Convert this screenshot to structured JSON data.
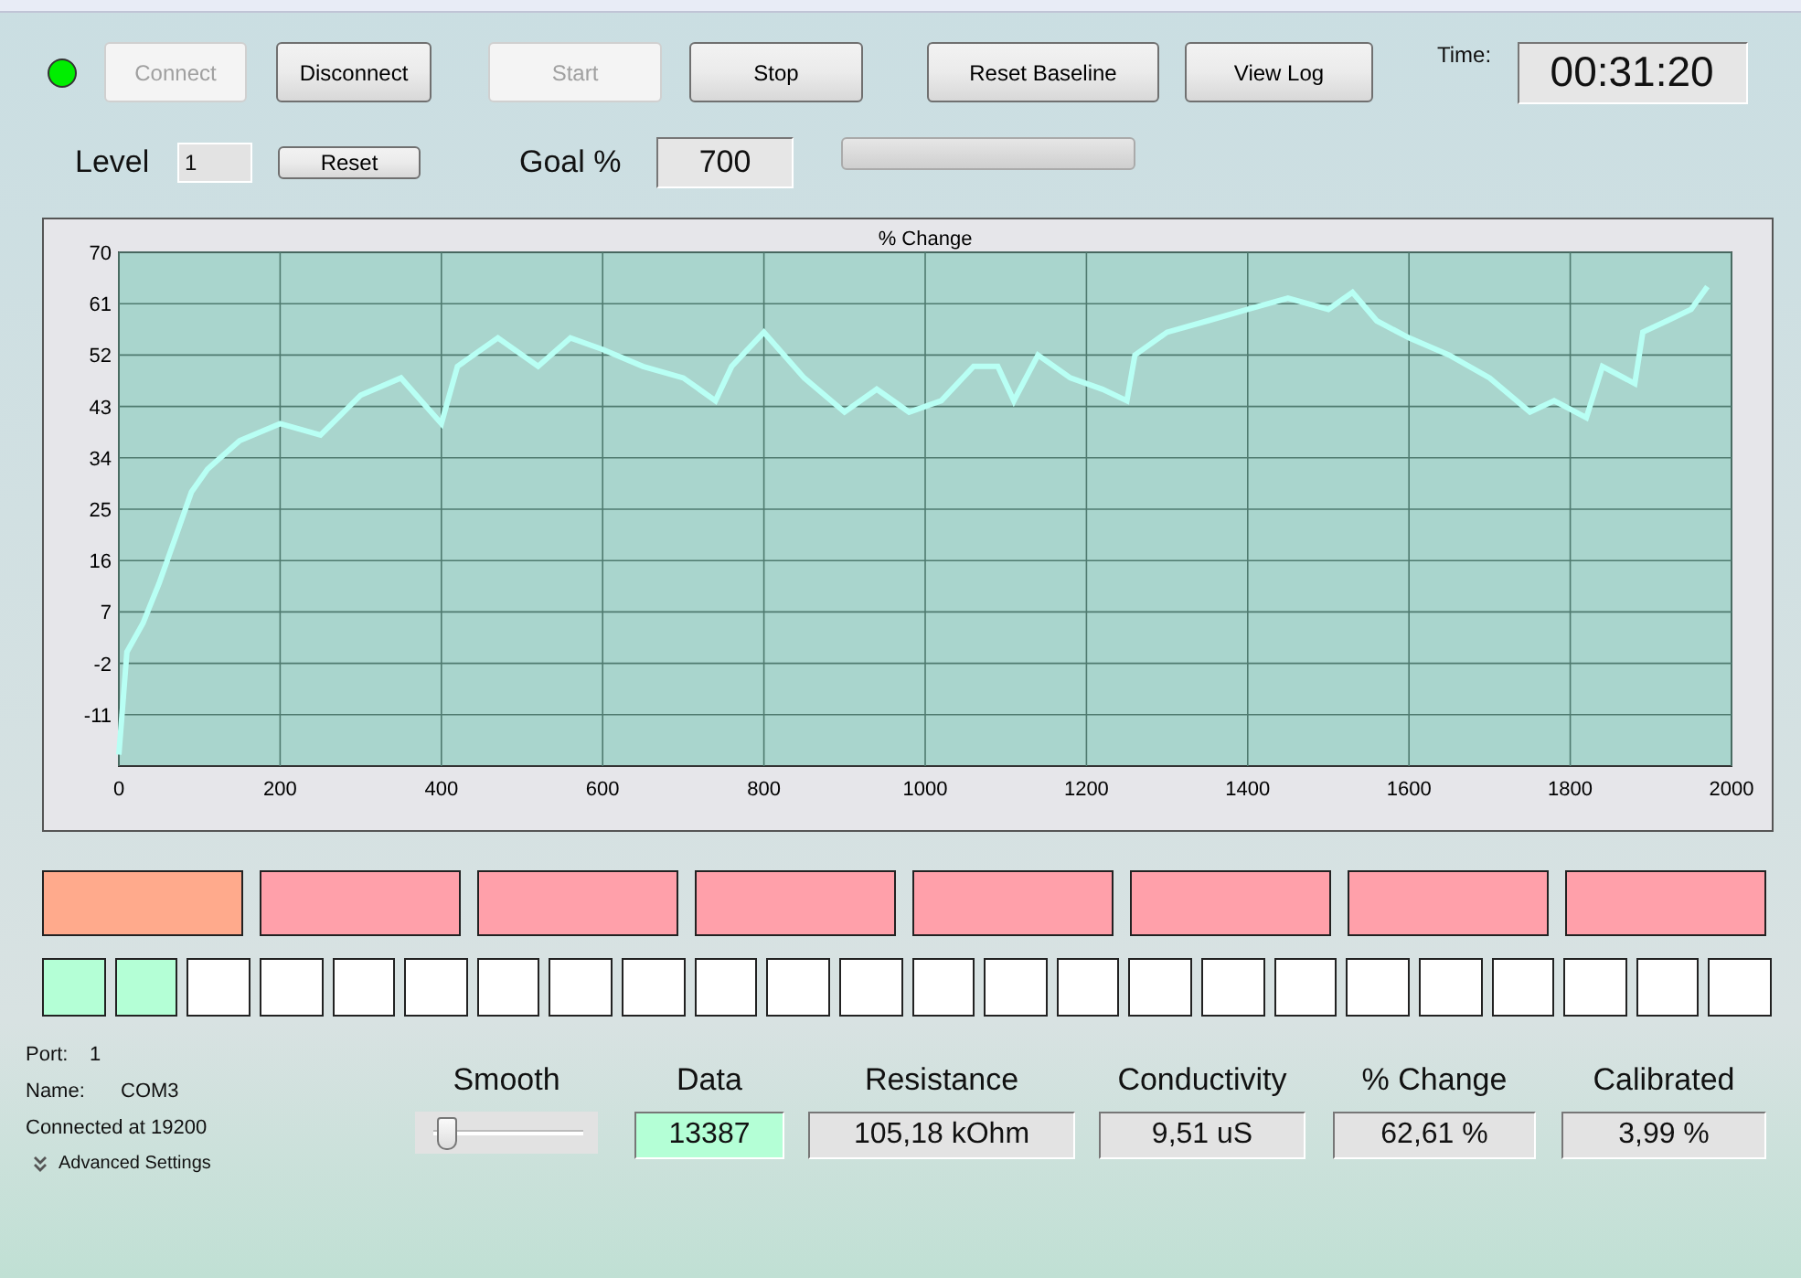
{
  "toolbar": {
    "status_led": {
      "on": true
    },
    "buttons": [
      {
        "label": "Connect",
        "disabled": true
      },
      {
        "label": "Disconnect",
        "disabled": false
      },
      {
        "label": "Start",
        "disabled": true
      },
      {
        "label": "Stop",
        "disabled": false
      },
      {
        "label": "Reset Baseline",
        "disabled": false
      },
      {
        "label": "View Log",
        "disabled": false
      }
    ],
    "time_label": "Time:",
    "time": "00:31:20"
  },
  "level_row": {
    "level_label": "Level",
    "level_value": "1",
    "reset_button": "Reset",
    "goal_label": "Goal %",
    "goal_value": "700",
    "progress": {
      "level": 0
    }
  },
  "chart_data": {
    "type": "line",
    "title": "% Change",
    "grid": true,
    "xlim": [
      0,
      2000
    ],
    "ylim": [
      -20,
      70
    ],
    "xticks": [
      0,
      200,
      400,
      600,
      800,
      1000,
      1200,
      1400,
      1600,
      1800,
      2000
    ],
    "yticks": [
      -11,
      -2,
      7,
      16,
      25,
      34,
      43,
      52,
      61,
      70
    ],
    "x": [
      0,
      10,
      30,
      50,
      70,
      90,
      110,
      150,
      200,
      250,
      300,
      350,
      400,
      420,
      470,
      520,
      560,
      600,
      650,
      700,
      740,
      760,
      800,
      850,
      900,
      940,
      980,
      1020,
      1060,
      1090,
      1110,
      1140,
      1180,
      1220,
      1250,
      1260,
      1300,
      1350,
      1400,
      1450,
      1500,
      1530,
      1560,
      1600,
      1650,
      1700,
      1750,
      1780,
      1820,
      1840,
      1880,
      1890,
      1920,
      1950,
      1970
    ],
    "series": [
      {
        "color": "#b8fff4",
        "values": [
          -18,
          0,
          5,
          12,
          20,
          28,
          32,
          37,
          40,
          38,
          45,
          48,
          40,
          50,
          55,
          50,
          55,
          53,
          50,
          48,
          44,
          50,
          56,
          48,
          42,
          46,
          42,
          44,
          50,
          50,
          44,
          52,
          48,
          46,
          44,
          52,
          56,
          58,
          60,
          62,
          60,
          63,
          58,
          55,
          52,
          48,
          42,
          44,
          41,
          50,
          47,
          56,
          58,
          60,
          64
        ]
      }
    ]
  },
  "stage_blocks": [
    {
      "color": "#ffaa8c"
    },
    {
      "color": "#ffa0aa"
    },
    {
      "color": "#ffa0aa"
    },
    {
      "color": "#ffa0aa"
    },
    {
      "color": "#ffa0aa"
    },
    {
      "color": "#ffa0aa"
    },
    {
      "color": "#ffa0aa"
    },
    {
      "color": "#ffa0aa"
    }
  ],
  "step_cells": [
    {
      "color": "#b4ffd6"
    },
    {
      "color": "#b4ffd6"
    },
    {
      "color": "#ffffff"
    },
    {
      "color": "#ffffff"
    },
    {
      "color": "#ffffff"
    },
    {
      "color": "#ffffff"
    },
    {
      "color": "#ffffff"
    },
    {
      "color": "#ffffff"
    },
    {
      "color": "#ffffff"
    },
    {
      "color": "#ffffff"
    },
    {
      "color": "#ffffff"
    },
    {
      "color": "#ffffff"
    },
    {
      "color": "#ffffff"
    },
    {
      "color": "#ffffff"
    },
    {
      "color": "#ffffff"
    },
    {
      "color": "#ffffff"
    },
    {
      "color": "#ffffff"
    },
    {
      "color": "#ffffff"
    },
    {
      "color": "#ffffff"
    },
    {
      "color": "#ffffff"
    },
    {
      "color": "#ffffff"
    },
    {
      "color": "#ffffff"
    },
    {
      "color": "#ffffff"
    },
    {
      "color": "#ffffff"
    }
  ],
  "connection": {
    "port_label": "Port:",
    "port": "1",
    "name_label": "Name:",
    "name": "COM3",
    "status": "Connected at 19200",
    "advanced": "Advanced Settings"
  },
  "smooth": {
    "label": "Smooth",
    "level": 0.05
  },
  "readouts": [
    {
      "label": "Data",
      "value": "13387",
      "highlighted": true
    },
    {
      "label": "Resistance",
      "value": "105,18 kOhm",
      "highlighted": false
    },
    {
      "label": "Conductivity",
      "value": "9,51 uS",
      "highlighted": false
    },
    {
      "label": "% Change",
      "value": "62,61 %",
      "highlighted": false
    },
    {
      "label": "Calibrated",
      "value": "3,99 %",
      "highlighted": false
    }
  ]
}
